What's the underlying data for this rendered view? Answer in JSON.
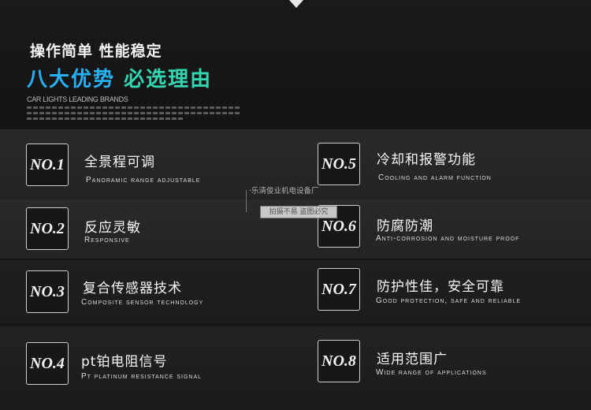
{
  "header": {
    "subtitle": "操作简单 性能稳定",
    "headline_part1": "八大优势",
    "headline_part2": "必选理由",
    "brand_line": "CAR LIGHTS LEADING BRANDS"
  },
  "watermark": {
    "top": "·乐清俊业机电设备厂",
    "box": "拍摄不易  盗图必究"
  },
  "features": [
    {
      "badge": "NO.1",
      "title": "全景程可调",
      "en": "Panoramic range adjustable"
    },
    {
      "badge": "NO.2",
      "title": "反应灵敏",
      "en": "Responsive"
    },
    {
      "badge": "NO.3",
      "title": "复合传感器技术",
      "en": "Composite sensor technology"
    },
    {
      "badge": "NO.4",
      "title": "pt铂电阻信号",
      "en": "Pt platinum resistance signal"
    },
    {
      "badge": "NO.5",
      "title": "冷却和报警功能",
      "en": "Cooling and alarm function"
    },
    {
      "badge": "NO.6",
      "title": "防腐防潮",
      "en": "Anti-corrosion and moisture proof"
    },
    {
      "badge": "NO.7",
      "title": "防护性佳，安全可靠",
      "en": "Good protection, safe and reliable"
    },
    {
      "badge": "NO.8",
      "title": "适用范围广",
      "en": "Wide range of applications"
    }
  ],
  "colors": {
    "accent_blue": "#27b0f2",
    "accent_green": "#33d6b0",
    "background": "#151515"
  }
}
